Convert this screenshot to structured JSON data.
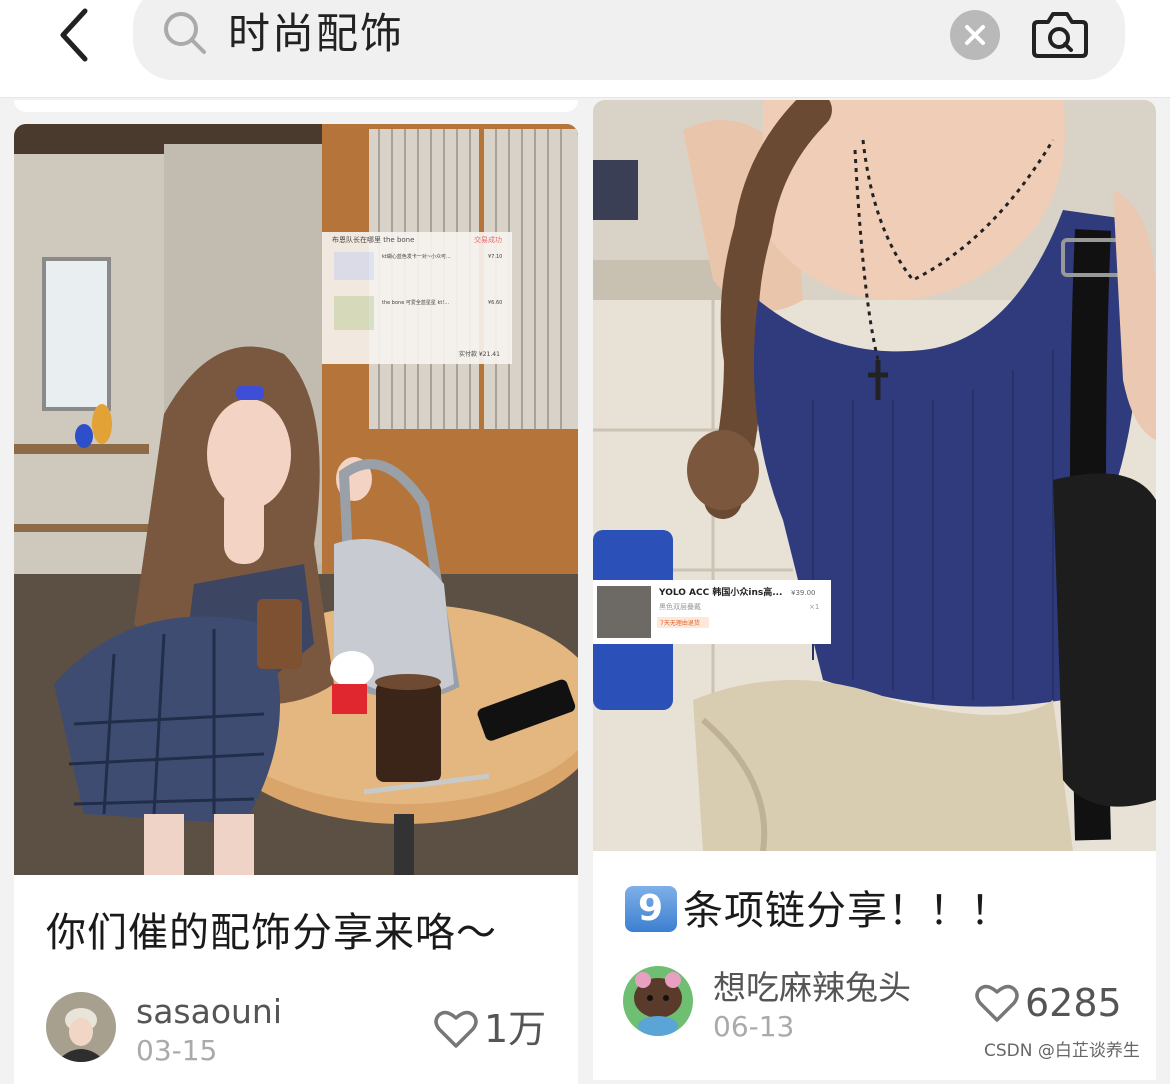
{
  "search": {
    "query": "时尚配饰"
  },
  "icons": {
    "back": "chevron-left-icon",
    "search": "search-icon",
    "clear": "clear-icon",
    "camera": "camera-search-icon",
    "heart": "heart-outline-icon"
  },
  "colors": {
    "background": "#f2f2f2",
    "card": "#ffffff",
    "text": "#1a1a1a",
    "muted": "#aaaaaa",
    "badge_blue": "#3c7fd0"
  },
  "posts": [
    {
      "title": "你们催的配饰分享来咯～",
      "author": "sasaouni",
      "date": "03-15",
      "likes": "1万"
    },
    {
      "badge": "9",
      "title": "条项链分享！！！",
      "author": "想吃麻辣兔头",
      "date": "06-13",
      "likes": "6285",
      "product_tag": {
        "name": "YOLO ACC 韩国小众ins高...",
        "price": "¥39.00",
        "variant": "黑色双层叠戴",
        "qty": "×1",
        "promo": "7天无理由退货"
      }
    }
  ],
  "left_overlay": {
    "shop": "布恩队长在哪里 the bone",
    "status": "交易成功",
    "item1": "kt蝴心蓝色发卡一对~小众可...",
    "item1_price": "¥7.10",
    "item2": "the bone 可爱全蓝星星 kt!...",
    "item2_price": "¥6.60",
    "total": "实付款 ¥21.41"
  },
  "watermark": "CSDN @白芷谈养生"
}
